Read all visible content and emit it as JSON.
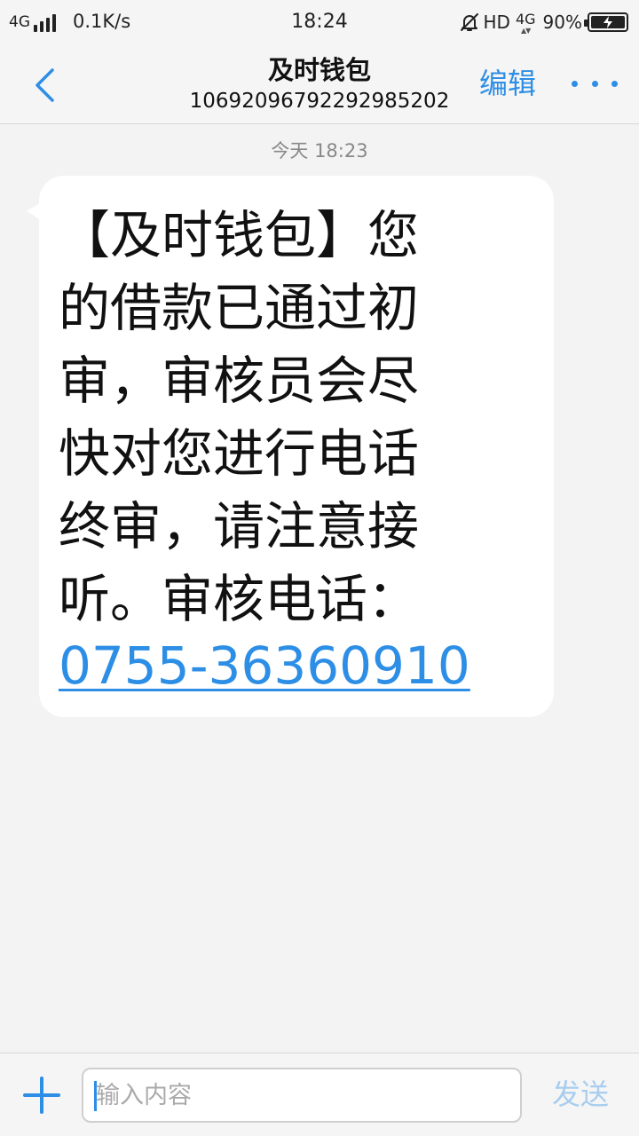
{
  "status_bar": {
    "network": "4G",
    "speed": "0.1K/s",
    "time": "18:24",
    "hd": "HD",
    "network_right": "4G",
    "battery": "90%"
  },
  "header": {
    "contact_name": "及时钱包",
    "contact_number": "1069209679229298520​2",
    "edit_label": "编辑"
  },
  "thread": {
    "timestamp": "今天 18:23",
    "message": {
      "text": "【及时钱包】您的借款已通过初审，审核员会尽快对您进行电话终审，请注意接听。审核电话：",
      "phone_link": "0755-36360910"
    }
  },
  "input_bar": {
    "placeholder": "输入内容",
    "send_label": "发送"
  },
  "colors": {
    "accent": "#2d8ee6",
    "send_disabled": "#a9cdef",
    "background": "#f3f3f3",
    "bubble": "#ffffff"
  },
  "icons": {
    "back": "chevron-left-icon",
    "more": "more-dots-icon",
    "add": "plus-icon",
    "mute": "bell-off-icon",
    "battery": "battery-charging-icon"
  }
}
